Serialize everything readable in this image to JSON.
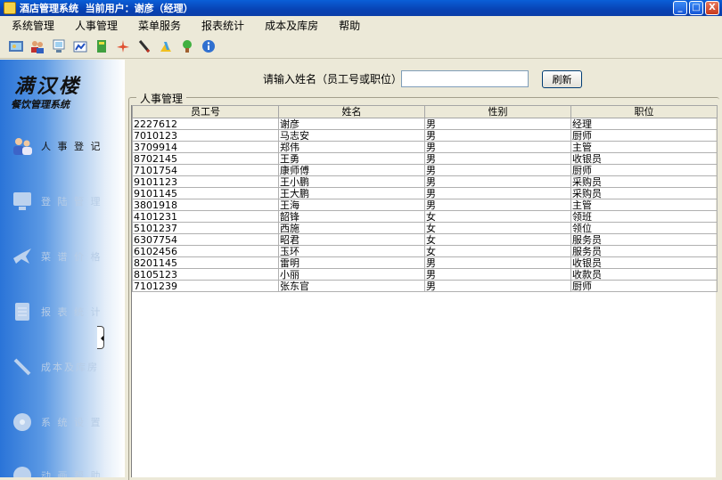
{
  "window": {
    "title": "酒店管理系统  当前用户：谢彦（经理）",
    "minimize": "_",
    "maximize": "□",
    "close": "X"
  },
  "menu": [
    "系统管理",
    "人事管理",
    "菜单服务",
    "报表统计",
    "成本及库房",
    "帮助"
  ],
  "toolbar_icons": [
    "photo-icon",
    "users-icon",
    "monitor-icon",
    "chart-icon",
    "book-icon",
    "plane-icon",
    "pen-icon",
    "tools-icon",
    "plant-icon",
    "info-icon"
  ],
  "sidebar": {
    "brand_title": "满汉楼",
    "brand_subtitle": "餐饮管理系统",
    "items": [
      {
        "label": "人 事 登 记",
        "icon": "people-icon",
        "active": true
      },
      {
        "label": "登 陆 管 理",
        "icon": "monitor-icon",
        "active": false
      },
      {
        "label": "菜 谱 价 格",
        "icon": "bird-icon",
        "active": false
      },
      {
        "label": "报 表 统 计",
        "icon": "document-icon",
        "active": false
      },
      {
        "label": "成本及库房",
        "icon": "tool-icon",
        "active": false
      },
      {
        "label": "系 统 设 置",
        "icon": "disc-icon",
        "active": false
      },
      {
        "label": "动 画 帮 助",
        "icon": "help-icon",
        "active": false
      }
    ]
  },
  "search": {
    "label": "请输入姓名（员工号或职位）:",
    "value": "",
    "button": "刷新"
  },
  "group_title": "人事管理",
  "table": {
    "columns": [
      "员工号",
      "姓名",
      "性别",
      "职位"
    ],
    "rows": [
      [
        "2227612",
        "谢彦",
        "男",
        "经理"
      ],
      [
        "7010123",
        "马志安",
        "男",
        "厨师"
      ],
      [
        "3709914",
        "郑伟",
        "男",
        "主管"
      ],
      [
        "8702145",
        "王勇",
        "男",
        "收银员"
      ],
      [
        "7101754",
        "康师傅",
        "男",
        "厨师"
      ],
      [
        "9101123",
        "王小鹏",
        "男",
        "采购员"
      ],
      [
        "9101145",
        "王大鹏",
        "男",
        "采购员"
      ],
      [
        "3801918",
        "王海",
        "男",
        "主管"
      ],
      [
        "4101231",
        "韶锋",
        "女",
        "领班"
      ],
      [
        "5101237",
        "西施",
        "女",
        "领位"
      ],
      [
        "6307754",
        "昭君",
        "女",
        "服务员"
      ],
      [
        "6102456",
        "玉环",
        "女",
        "服务员"
      ],
      [
        "8201145",
        "雷明",
        "男",
        "收银员"
      ],
      [
        "8105123",
        "小丽",
        "男",
        "收款员"
      ],
      [
        "7101239",
        "张东官",
        "男",
        "厨师"
      ]
    ]
  }
}
